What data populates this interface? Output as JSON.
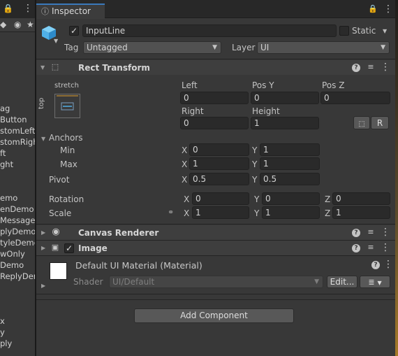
{
  "hierarchy": {
    "items": [
      "ag",
      "Button",
      "stomLeft",
      "stomRigh",
      "ft",
      "ght",
      "emo",
      "enDemo",
      "Message",
      "plyDemo",
      "tyleDemo",
      "wOnly",
      "Demo",
      "ReplyDen",
      "x",
      "y",
      "ply"
    ]
  },
  "tab": {
    "label": "Inspector"
  },
  "object": {
    "active": true,
    "name": "InputLine",
    "static_label": "Static",
    "static": false,
    "tag_label": "Tag",
    "tag_value": "Untagged",
    "layer_label": "Layer",
    "layer_value": "UI"
  },
  "rect_transform": {
    "title": "Rect Transform",
    "anchor_preset": {
      "top_label": "stretch",
      "side_label": "top"
    },
    "row1": {
      "labels": [
        "Left",
        "Pos Y",
        "Pos Z"
      ],
      "values": [
        "0",
        "0",
        "0"
      ]
    },
    "row2": {
      "labels": [
        "Right",
        "Height"
      ],
      "values": [
        "0",
        "1"
      ]
    },
    "raw_button": "R",
    "anchors": {
      "label": "Anchors",
      "min_label": "Min",
      "min_x": "0",
      "min_y": "1",
      "max_label": "Max",
      "max_x": "1",
      "max_y": "1"
    },
    "pivot": {
      "label": "Pivot",
      "x": "0.5",
      "y": "0.5"
    },
    "rotation": {
      "label": "Rotation",
      "x": "0",
      "y": "0",
      "z": "0"
    },
    "scale": {
      "label": "Scale",
      "x": "1",
      "y": "1",
      "z": "1"
    },
    "axis": {
      "x": "X",
      "y": "Y",
      "z": "Z"
    }
  },
  "canvas_renderer": {
    "title": "Canvas Renderer"
  },
  "image": {
    "title": "Image",
    "enabled": true
  },
  "material": {
    "name": "Default UI Material (Material)",
    "shader_label": "Shader",
    "shader_value": "UI/Default",
    "edit_button": "Edit..."
  },
  "add_component": {
    "label": "Add Component"
  },
  "colors": {
    "accent": "#3a79bb",
    "panel": "#383838",
    "field": "#2a2a2a",
    "cube": "#4fb0e8"
  }
}
